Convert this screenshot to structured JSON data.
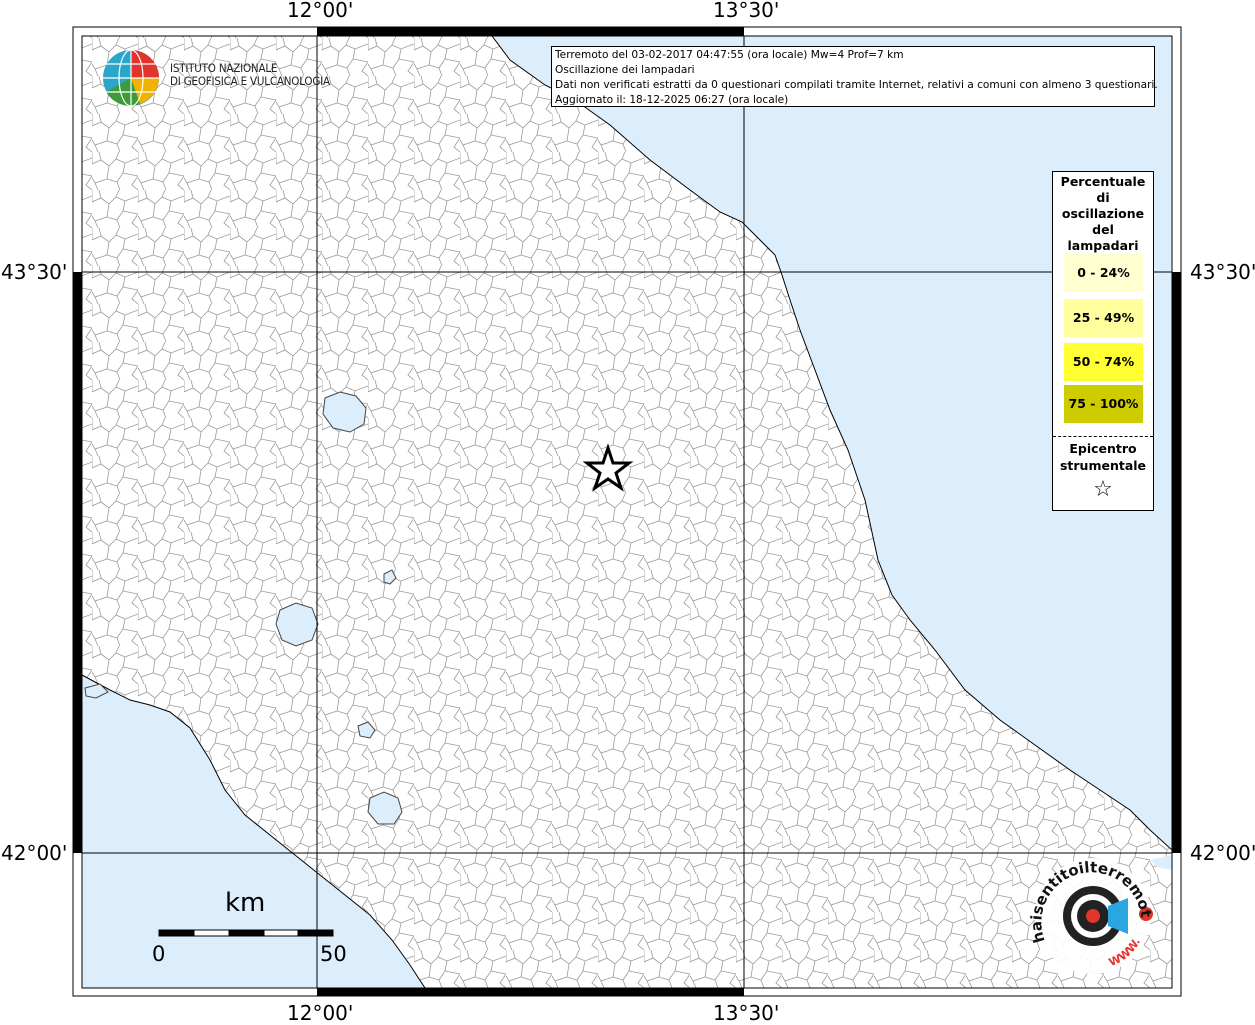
{
  "map": {
    "longitude_labels": [
      "12°00'",
      "13°30'"
    ],
    "latitude_labels": [
      "43°30'",
      "42°00'"
    ],
    "colors": {
      "sea": "#dcedfb",
      "land": "#ffffff",
      "border_lines": "#9a9a9a",
      "grid": "#000000"
    }
  },
  "info": {
    "line1": "Terremoto del 03-02-2017 04:47:55 (ora locale) Mw=4 Prof=7 km",
    "line2": "Oscillazione dei lampadari",
    "line3": "Dati non verificati estratti da 0 questionari compilati tramite Internet, relativi a comuni con almeno 3 questionari.",
    "line4": "Aggiornato il: 18-12-2025 06:27 (ora locale)"
  },
  "logo": {
    "line1": "ISTITUTO NAZIONALE",
    "line2": "DI GEOFISICA E VULCANOLOGIA"
  },
  "legend": {
    "title_lines": [
      "Percentuale",
      "di",
      "oscillazione",
      "del",
      "lampadari"
    ],
    "bins": [
      {
        "label": "0 - 24%",
        "color": "#ffffd0"
      },
      {
        "label": "25 - 49%",
        "color": "#ffff9e"
      },
      {
        "label": "50 - 74%",
        "color": "#ffff33"
      },
      {
        "label": "75 - 100%",
        "color": "#cccc00"
      }
    ],
    "epicenter_line1": "Epicentro",
    "epicenter_line2": "strumentale",
    "epicenter_symbol": "star-icon"
  },
  "scale": {
    "unit": "km",
    "min_label": "0",
    "max_label": "50"
  },
  "badge": {
    "text_main": "haisentitoilterremoto",
    "text_it": ".it",
    "text_www": "WWW."
  }
}
